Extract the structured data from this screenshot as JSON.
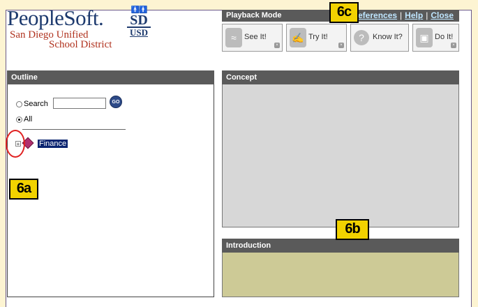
{
  "branding": {
    "product": "PeopleSoft.",
    "org_line1": "San Diego Unified",
    "org_line2": "School District",
    "logo_top": "SD",
    "logo_bottom": "USD"
  },
  "playback": {
    "title": "Playback Mode",
    "links": [
      "Preferences",
      "Help",
      "Close"
    ],
    "separator": "|",
    "modes": [
      {
        "label": "See It!",
        "icon": "see-it-icon"
      },
      {
        "label": "Try It!",
        "icon": "try-it-icon"
      },
      {
        "label": "Know It?",
        "icon": "know-it-icon"
      },
      {
        "label": "Do It!",
        "icon": "do-it-icon"
      }
    ]
  },
  "outline": {
    "title": "Outline",
    "search_label": "Search",
    "search_value": "",
    "go_label": "GO",
    "all_label": "All",
    "selected_option": "All",
    "tree": [
      {
        "label": "Finance",
        "expander": "+",
        "selected": true
      }
    ]
  },
  "concept": {
    "title": "Concept"
  },
  "introduction": {
    "title": "Introduction"
  },
  "annotations": {
    "tag_a": "6a",
    "tag_b": "6b",
    "tag_c": "6c"
  },
  "colors": {
    "header_bg": "#5a5a5a",
    "concept_bg": "#d7d7d7",
    "intro_bg": "#cdca96",
    "tag_bg": "#f2d200",
    "page_bg": "#fdf4d2"
  }
}
